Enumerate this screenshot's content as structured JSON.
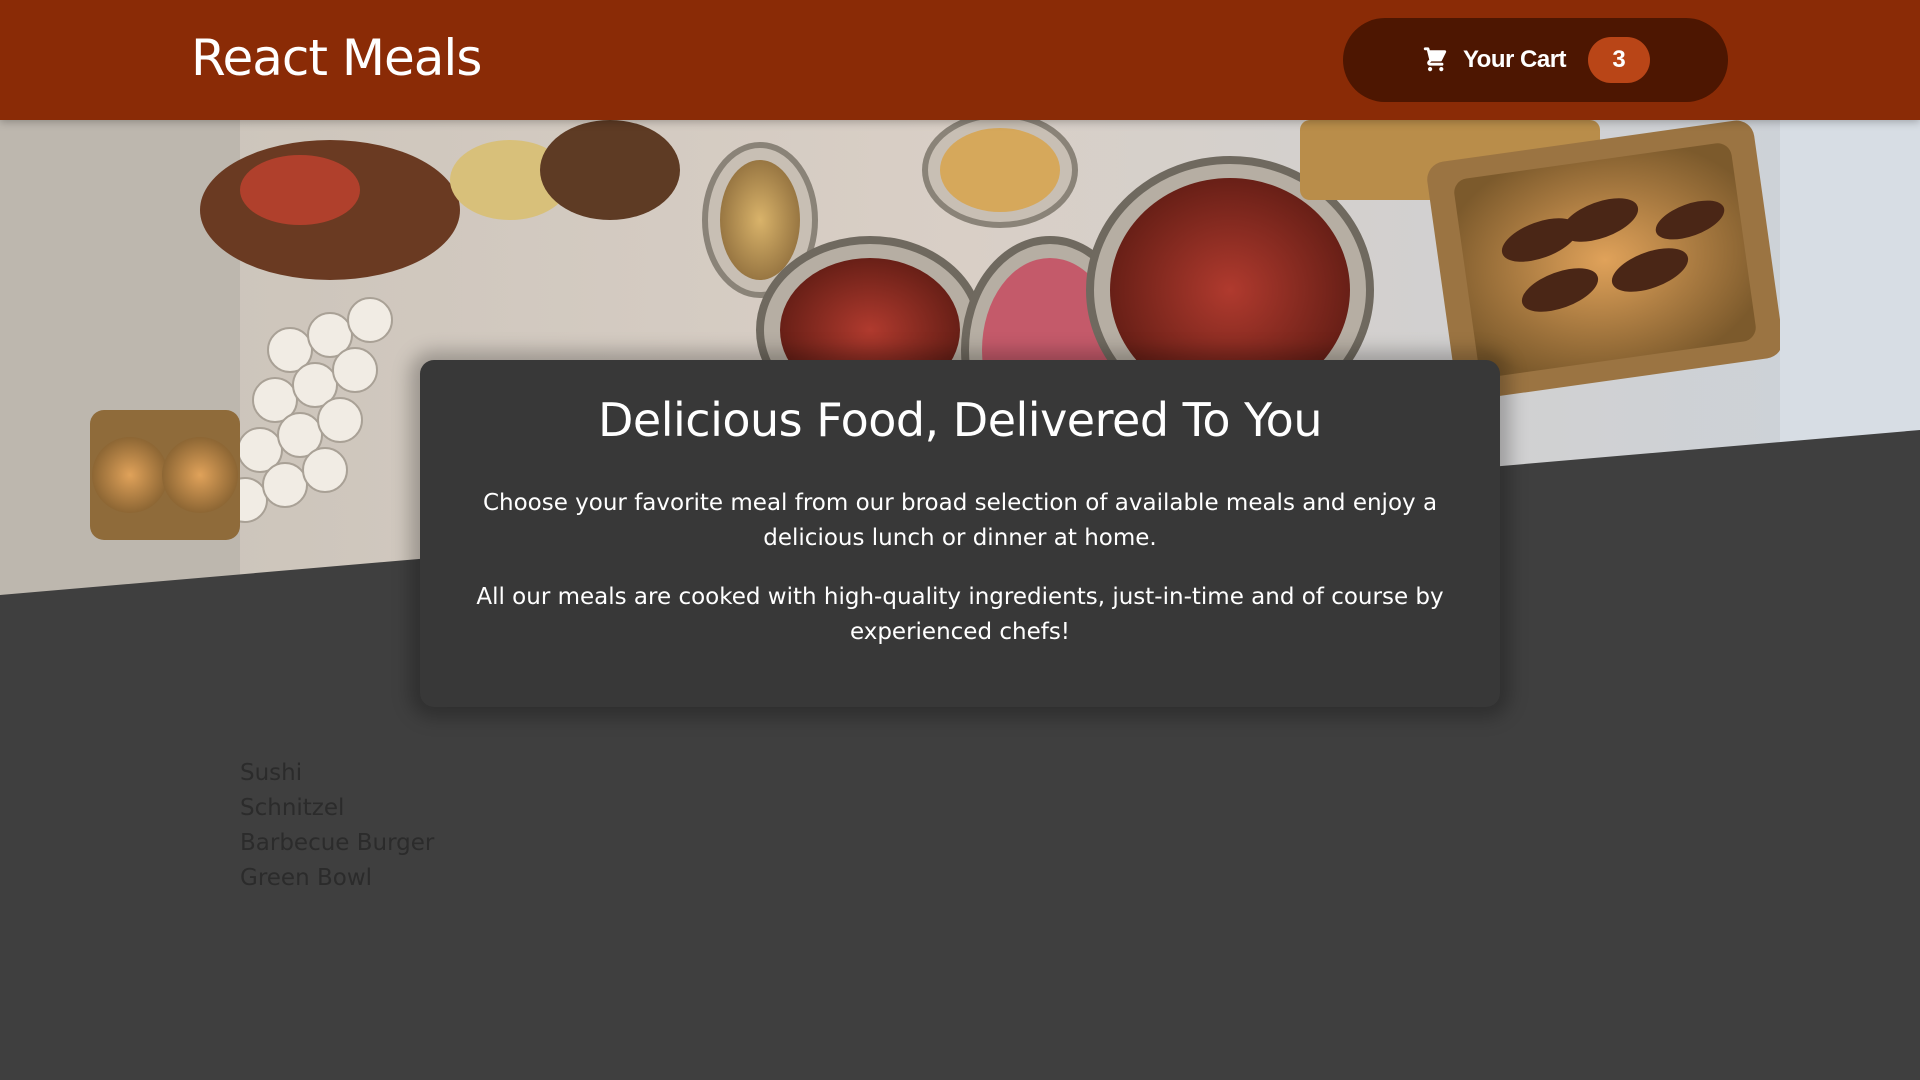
{
  "header": {
    "title": "React Meals",
    "cart": {
      "label": "Your Cart",
      "count": "3",
      "icon": "cart-icon"
    }
  },
  "summary": {
    "title": "Delicious Food, Delivered To You",
    "paragraphs": [
      "Choose your favorite meal from our broad selection of available meals and enjoy a delicious lunch or dinner at home.",
      "All our meals are cooked with high-quality ingredients, just-in-time and of course by experienced chefs!"
    ]
  },
  "meals": [
    "Sushi",
    "Schnitzel",
    "Barbecue Burger",
    "Green Bowl"
  ],
  "colors": {
    "header": "#8a2b06",
    "cart_button": "#4d1601",
    "cart_badge": "#b94517",
    "page_background": "#3f3f3f",
    "card_background": "#383838"
  }
}
